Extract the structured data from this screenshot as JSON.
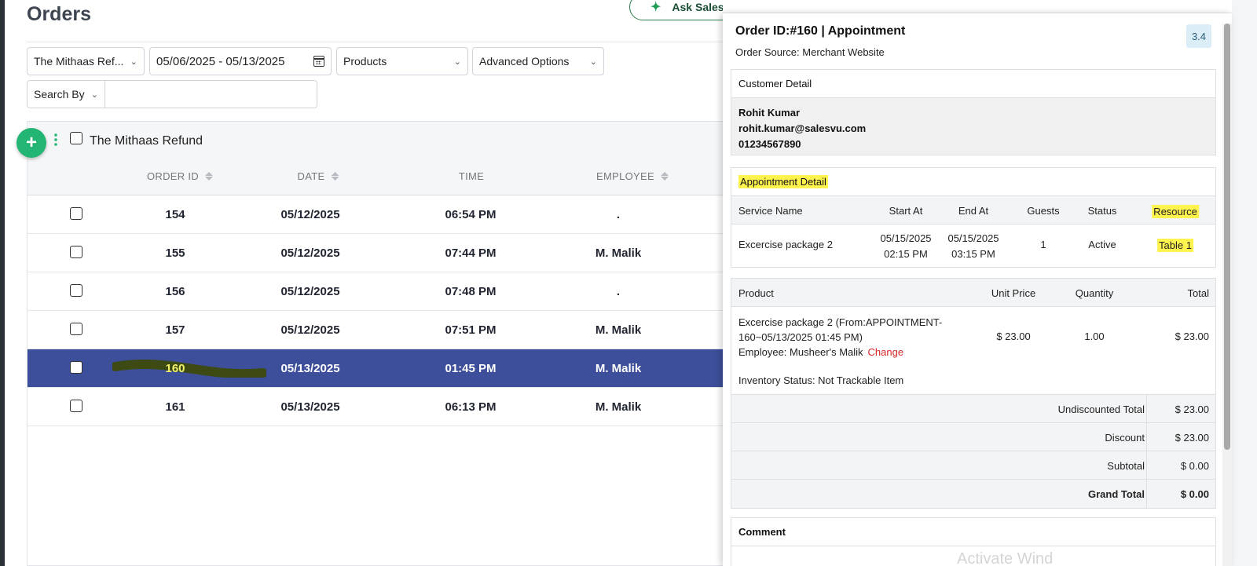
{
  "page": {
    "title": "Orders",
    "ask_label": "Ask SalesVu"
  },
  "filters": {
    "store": "The Mithaas Ref...",
    "date_range": "05/06/2025 - 05/13/2025",
    "products": "Products",
    "advanced": "Advanced Options",
    "search_by": "Search By",
    "search_value": ""
  },
  "grid": {
    "group_label": "The Mithaas Refund",
    "columns": [
      "ORDER ID",
      "DATE",
      "TIME",
      "EMPLOYEE"
    ],
    "rows": [
      {
        "id": "154",
        "date": "05/12/2025",
        "time": "06:54 PM",
        "employee": "."
      },
      {
        "id": "155",
        "date": "05/12/2025",
        "time": "07:44 PM",
        "employee": "M. Malik"
      },
      {
        "id": "156",
        "date": "05/12/2025",
        "time": "07:48 PM",
        "employee": "."
      },
      {
        "id": "157",
        "date": "05/12/2025",
        "time": "07:51 PM",
        "employee": "M. Malik"
      },
      {
        "id": "160",
        "date": "05/13/2025",
        "time": "01:45 PM",
        "employee": "M. Malik"
      },
      {
        "id": "161",
        "date": "05/13/2025",
        "time": "06:13 PM",
        "employee": "M. Malik"
      }
    ],
    "selected_index": 4
  },
  "panel": {
    "title": "Order ID:#160 | Appointment",
    "source": "Order Source: Merchant Website",
    "version": "3.4",
    "customer": {
      "heading": "Customer Detail",
      "name": "Rohit Kumar",
      "email": "rohit.kumar@salesvu.com",
      "phone": "01234567890"
    },
    "appointment": {
      "heading": "Appointment Detail",
      "columns": [
        "Service Name",
        "Start At",
        "End At",
        "Guests",
        "Status",
        "Resource"
      ],
      "service": "Excercise package 2",
      "start_date": "05/15/2025",
      "start_time": "02:15 PM",
      "end_date": "05/15/2025",
      "end_time": "03:15 PM",
      "guests": "1",
      "status": "Active",
      "resource": "Table 1"
    },
    "products": {
      "columns": [
        "Product",
        "Unit Price",
        "Quantity",
        "Total"
      ],
      "name_line1": "Excercise package 2 (From:APPOINTMENT-",
      "name_line2": "160~05/13/2025 01:45 PM)",
      "employee": "Employee: Musheer's Malik",
      "change_label": "Change",
      "unit_price": "$ 23.00",
      "quantity": "1.00",
      "total": "$ 23.00",
      "inventory": "Inventory Status: Not Trackable Item"
    },
    "totals": [
      {
        "label": "Undiscounted Total",
        "value": "$ 23.00",
        "bold": false
      },
      {
        "label": "Discount",
        "value": "$ 23.00",
        "bold": false
      },
      {
        "label": "Subtotal",
        "value": "$ 0.00",
        "bold": false
      },
      {
        "label": "Grand Total",
        "value": "$ 0.00",
        "bold": true
      }
    ],
    "comment_heading": "Comment",
    "watermark": "Activate Wind"
  },
  "colors": {
    "accent_green": "#22b573",
    "selected_row": "#3d4f9a",
    "highlight": "#fff34d",
    "change_red": "#d62626"
  }
}
